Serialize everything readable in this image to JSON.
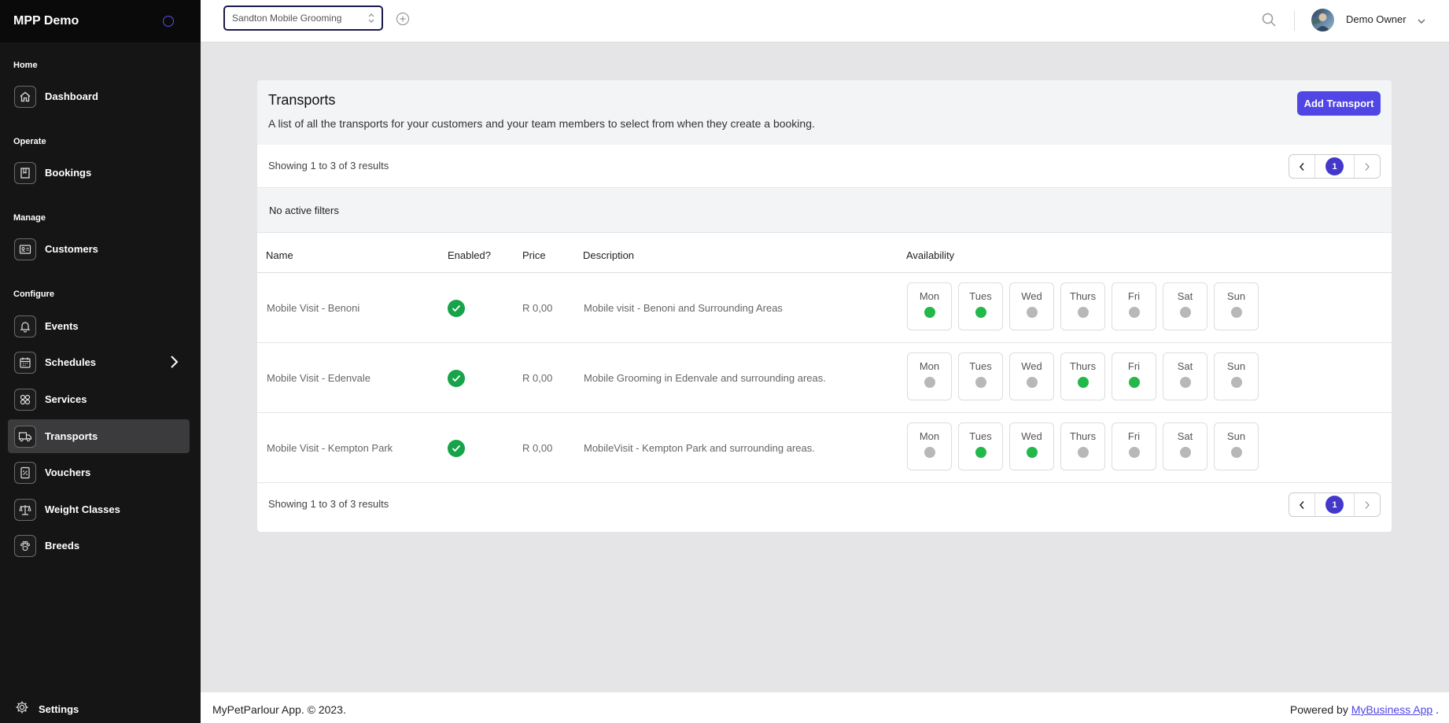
{
  "sidebar": {
    "brand": "MPP Demo",
    "sections": {
      "home": "Home",
      "operate": "Operate",
      "manage": "Manage",
      "configure": "Configure"
    },
    "items": {
      "dashboard": "Dashboard",
      "bookings": "Bookings",
      "customers": "Customers",
      "events": "Events",
      "schedules": "Schedules",
      "services": "Services",
      "transports": "Transports",
      "vouchers": "Vouchers",
      "weight_classes": "Weight Classes",
      "breeds": "Breeds"
    },
    "settings": "Settings",
    "active": "transports"
  },
  "topbar": {
    "salon_value": "Sandton Mobile Grooming",
    "user_name": "Demo Owner"
  },
  "page": {
    "title": "Transports",
    "description": "A list of all the transports for your customers and your team members to select from when they create a booking.",
    "add_button": "Add Transport",
    "results_text": "Showing 1 to 3 of 3 results",
    "current_page": "1",
    "filters_text": "No active filters"
  },
  "table": {
    "headers": {
      "name": "Name",
      "enabled": "Enabled?",
      "price": "Price",
      "description": "Description",
      "availability": "Availability"
    },
    "days": [
      "Mon",
      "Tues",
      "Wed",
      "Thurs",
      "Fri",
      "Sat",
      "Sun"
    ],
    "rows": [
      {
        "name": "Mobile Visit - Benoni",
        "enabled": true,
        "price": "R 0,00",
        "description": "Mobile visit - Benoni and Surrounding Areas",
        "availability": [
          true,
          true,
          false,
          false,
          false,
          false,
          false
        ]
      },
      {
        "name": "Mobile Visit - Edenvale",
        "enabled": true,
        "price": "R 0,00",
        "description": "Mobile Grooming in Edenvale and surrounding areas.",
        "availability": [
          false,
          false,
          false,
          true,
          true,
          false,
          false
        ]
      },
      {
        "name": "Mobile Visit - Kempton Park",
        "enabled": true,
        "price": "R 0,00",
        "description": "MobileVisit - Kempton Park and surrounding areas.",
        "availability": [
          false,
          true,
          true,
          false,
          false,
          false,
          false
        ]
      }
    ]
  },
  "footer": {
    "copyright": "MyPetParlour App. © 2023.",
    "powered_by": "Powered by",
    "powered_link": "MyBusiness App",
    "powered_suffix": "."
  },
  "colors": {
    "accent": "#4f46e5",
    "enabled_green": "#16a34a",
    "available_dot": "#22b84a",
    "unavailable_dot": "#b8b8b8",
    "sidebar_bg": "#151515"
  }
}
